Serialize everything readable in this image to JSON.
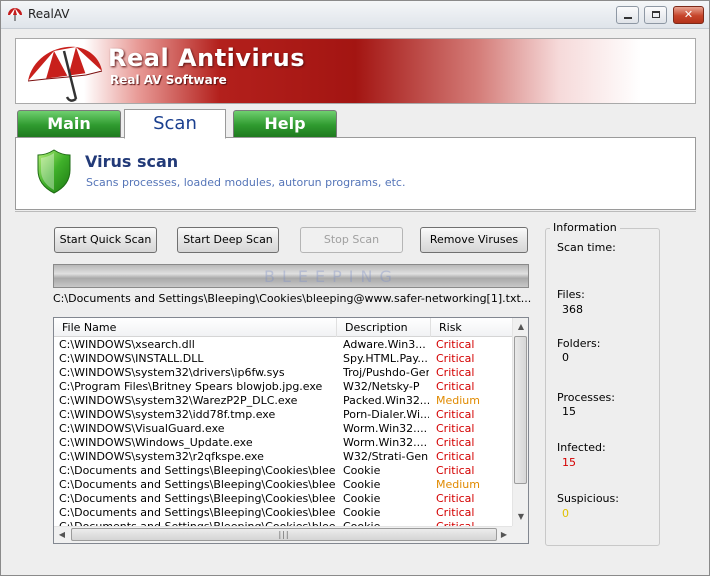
{
  "window": {
    "title": "RealAV"
  },
  "banner": {
    "title": "Real Antivirus",
    "subtitle": "Real AV Software"
  },
  "tabs": [
    {
      "label": "Main",
      "active": false
    },
    {
      "label": "Scan",
      "active": true
    },
    {
      "label": "Help",
      "active": false
    }
  ],
  "header": {
    "title": "Virus scan",
    "subtitle": "Scans processes, loaded modules, autorun programs, etc."
  },
  "buttons": {
    "quick_scan": "Start Quick Scan",
    "deep_scan": "Start Deep Scan",
    "stop_scan": "Stop Scan",
    "remove_viruses": "Remove Viruses"
  },
  "progress": {
    "fraction": 1.0,
    "watermark": "BLEEPING"
  },
  "current_path": "C:\\Documents and Settings\\Bleeping\\Cookies\\bleeping@www.safer-networking[1].txt...",
  "table": {
    "columns": [
      "File Name",
      "Description",
      "Risk"
    ],
    "rows": [
      {
        "file": "C:\\WINDOWS\\xsearch.dll",
        "desc": "Adware.Win3...",
        "risk": "Critical"
      },
      {
        "file": "C:\\WINDOWS\\INSTALL.DLL",
        "desc": "Spy.HTML.Pay...",
        "risk": "Critical"
      },
      {
        "file": "C:\\WINDOWS\\system32\\drivers\\ip6fw.sys",
        "desc": "Troj/Pushdo-Gen",
        "risk": "Critical"
      },
      {
        "file": "C:\\Program Files\\Britney Spears blowjob.jpg.exe",
        "desc": "W32/Netsky-P",
        "risk": "Critical"
      },
      {
        "file": "C:\\WINDOWS\\system32\\WarezP2P_DLC.exe",
        "desc": "Packed.Win32...",
        "risk": "Medium"
      },
      {
        "file": "C:\\WINDOWS\\system32\\idd78f.tmp.exe",
        "desc": "Porn-Dialer.Wi...",
        "risk": "Critical"
      },
      {
        "file": "C:\\WINDOWS\\VisualGuard.exe",
        "desc": "Worm.Win32....",
        "risk": "Critical"
      },
      {
        "file": "C:\\WINDOWS\\Windows_Update.exe",
        "desc": "Worm.Win32....",
        "risk": "Critical"
      },
      {
        "file": "C:\\WINDOWS\\system32\\r2qfkspe.exe",
        "desc": "W32/Strati-Gen",
        "risk": "Critical"
      },
      {
        "file": "C:\\Documents and Settings\\Bleeping\\Cookies\\bleeping...",
        "desc": "Cookie",
        "risk": "Critical"
      },
      {
        "file": "C:\\Documents and Settings\\Bleeping\\Cookies\\bleeping...",
        "desc": "Cookie",
        "risk": "Medium"
      },
      {
        "file": "C:\\Documents and Settings\\Bleeping\\Cookies\\bleeping...",
        "desc": "Cookie",
        "risk": "Critical"
      },
      {
        "file": "C:\\Documents and Settings\\Bleeping\\Cookies\\bleeping...",
        "desc": "Cookie",
        "risk": "Critical"
      },
      {
        "file": "C:\\Documents and Settings\\Bleeping\\Cookies\\bleeping...",
        "desc": "Cookie",
        "risk": "Critical"
      }
    ]
  },
  "risk_colors": {
    "Critical": "#d40000",
    "Medium": "#e08a00"
  },
  "info": {
    "legend": "Information",
    "scan_time_label": "Scan time:",
    "scan_time": "",
    "files_label": "Files:",
    "files": "368",
    "folders_label": "Folders:",
    "folders": "0",
    "processes_label": "Processes:",
    "processes": "15",
    "infected_label": "Infected:",
    "infected": "15",
    "suspicious_label": "Suspicious:",
    "suspicious": "0"
  },
  "colors": {
    "infected_value": "#d40000",
    "suspicious_value": "#e0c000",
    "tab_text_active": "#1a3f8f",
    "header_title": "#223a78"
  },
  "icons": {
    "app": "umbrella-icon",
    "logo": "umbrella-logo",
    "shield": "shield-icon"
  }
}
